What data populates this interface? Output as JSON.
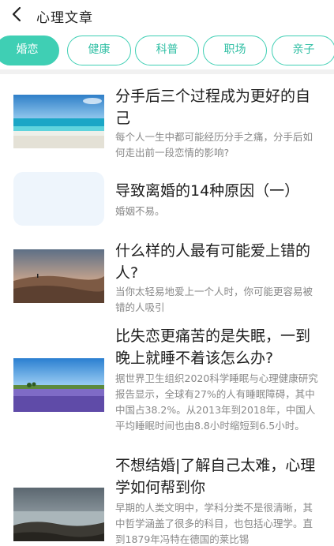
{
  "header": {
    "title": "心理文章"
  },
  "tabs": [
    {
      "label": "婚恋",
      "active": true
    },
    {
      "label": "健康",
      "active": false
    },
    {
      "label": "科普",
      "active": false
    },
    {
      "label": "职场",
      "active": false
    },
    {
      "label": "亲子",
      "active": false
    }
  ],
  "articles": [
    {
      "title": "分手后三个过程成为更好的自己",
      "desc": "每个人一生中都可能经历分手之痛，分手后如何走出前一段恋情的影响?",
      "image": "beach-sea-photo"
    },
    {
      "title": "导致离婚的14种原因（一）",
      "desc": "婚姻不易。",
      "image": "blank-placeholder"
    },
    {
      "title": "什么样的人最有可能爱上错的人?",
      "desc": "当你太轻易地爱上一个人时，你可能更容易被错的人吸引",
      "image": "desert-dune-photo"
    },
    {
      "title": "比失恋更痛苦的是失眠，一到晚上就睡不着该怎么办?",
      "desc": "据世界卫生组织2020科学睡眠与心理健康研究报告显示，全球有27%的人有睡眠障碍，其中中国占38.2%。从2013年到2018年，中国人平均睡眠时间也由8.8小时缩短到6.5小时。",
      "image": "lavender-field-photo"
    },
    {
      "title": "不想结婚|了解自己太难，心理学如何帮到你",
      "desc": "早期的人类文明中，学科分类不是很清晰，其中哲学涵盖了很多的科目，也包括心理学。直到1879年冯特在德国的莱比锡",
      "image": "rocky-coast-photo"
    }
  ],
  "colors": {
    "accent": "#3fcfb4",
    "title_text": "#1d1d1d",
    "desc_text": "#888888"
  }
}
